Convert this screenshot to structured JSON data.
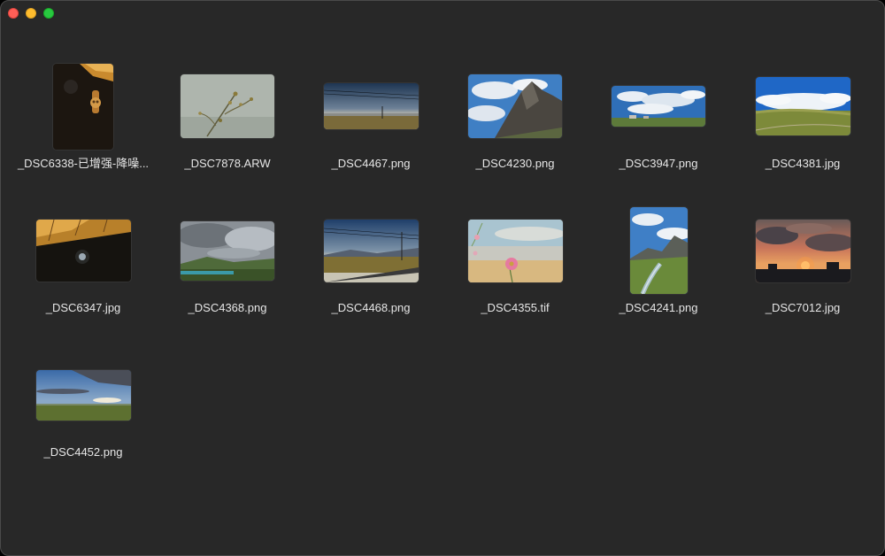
{
  "window": {
    "controls": [
      "close",
      "minimize",
      "zoom"
    ]
  },
  "files": [
    {
      "name": "_DSC6338-已增强-降噪...",
      "scene": "night-lamp",
      "orientation": "portrait"
    },
    {
      "name": "_DSC7878.ARW",
      "scene": "branch-mist",
      "orientation": "landscape"
    },
    {
      "name": "_DSC4467.png",
      "scene": "power-lines-plain",
      "orientation": "panorama"
    },
    {
      "name": "_DSC4230.png",
      "scene": "mountain-peak",
      "orientation": "landscape"
    },
    {
      "name": "_DSC3947.png",
      "scene": "cloud-sky-wide",
      "orientation": "panorama"
    },
    {
      "name": "_DSC4381.jpg",
      "scene": "blue-sky-grassland",
      "orientation": "landscape"
    },
    {
      "name": "_DSC6347.jpg",
      "scene": "night-moon-lamp",
      "orientation": "landscape"
    },
    {
      "name": "_DSC4368.png",
      "scene": "cloudy-lake",
      "orientation": "landscape"
    },
    {
      "name": "_DSC4468.png",
      "scene": "road-power-lines",
      "orientation": "landscape"
    },
    {
      "name": "_DSC4355.tif",
      "scene": "pink-flower",
      "orientation": "landscape"
    },
    {
      "name": "_DSC4241.png",
      "scene": "stream-mountain",
      "orientation": "portrait"
    },
    {
      "name": "_DSC7012.jpg",
      "scene": "sunset",
      "orientation": "landscape"
    },
    {
      "name": "_DSC4452.png",
      "scene": "grassland-horizon",
      "orientation": "panorama"
    }
  ]
}
